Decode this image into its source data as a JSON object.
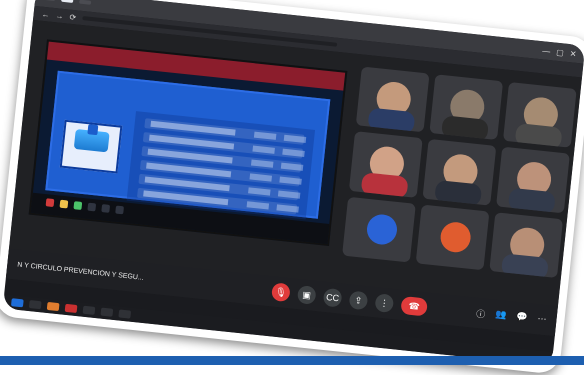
{
  "browser": {
    "tabs": [
      "",
      "",
      ""
    ],
    "address": ""
  },
  "shared_screen": {
    "inner_tabs": [
      "",
      "",
      "",
      ""
    ],
    "slide_title": "",
    "logo_text": ""
  },
  "participants": [
    {
      "name": ""
    },
    {
      "name": ""
    },
    {
      "name": ""
    },
    {
      "name": ""
    },
    {
      "name": ""
    },
    {
      "name": ""
    },
    {
      "name": "",
      "avatar_letter": "",
      "avatar_color": "#2a63d6"
    },
    {
      "name": "",
      "avatar_letter": "",
      "avatar_color": "#e05c2f"
    },
    {
      "name": ""
    }
  ],
  "meeting": {
    "title": "N Y CÍRCULO PREVENCIÓN Y SEGU..."
  },
  "colors": {
    "accent_blue": "#1d5fb0",
    "end_call_red": "#e03b3b"
  },
  "taskbar": {
    "time": ""
  }
}
